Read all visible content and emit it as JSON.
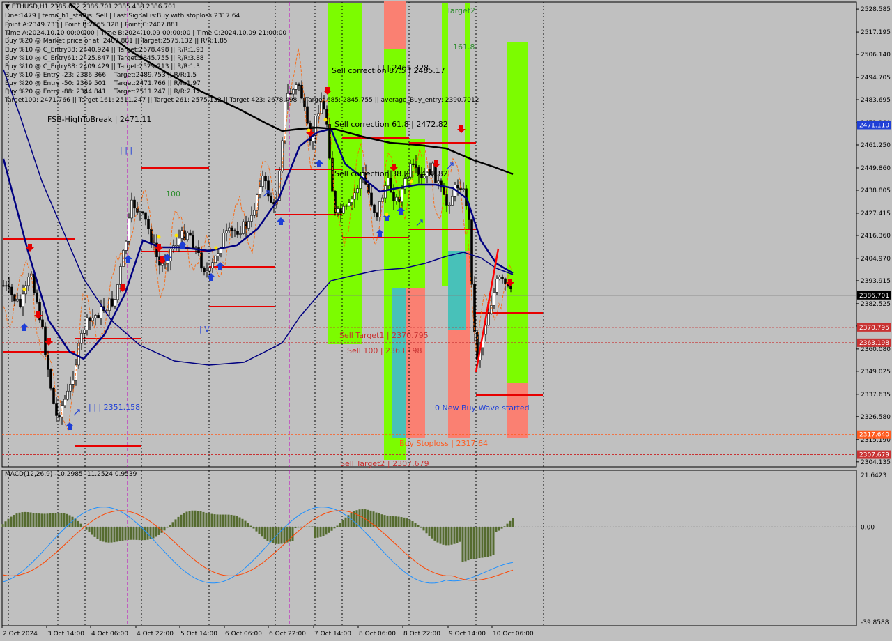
{
  "header": {
    "symbol_line": "ETHUSD,H1  2385.672 2386.701 2385.438 2386.701",
    "lines": [
      "Line:1479 | tema_h1_status: Sell | Last Signal is:Buy with stoploss:2317.64",
      "Point A:2349.733 | Point B:2465.328 | Point C:2407.881",
      "Time A:2024.10.10 00:00:00 | Time B:2024.10.09 00:00:00 | Time C:2024.10.09 21:00:00",
      "Buy %20 @ Market price or at: 2407.881 || Target:2575.132 || R/R:1.85",
      "Buy %10 @ C_Entry38: 2440.924 || Target:2678.498 || R/R:1.93",
      "Buy %10 @ C_Entry61: 2425.847 || Target:2845.755 || R/R:3.88",
      "Buy %10 @ C_Entry88: 2409.429 || Target:2529.213 || R/R:1.3",
      "Buy %10 @ Entry -23: 2386.366 || Target:2489.753 || R/R:1.5",
      "Buy %20 @ Entry -50: 2369.501 || Target:2471.766 || R/R:1.97",
      "Buy %20 @ Entry -88: 2344.841 || Target:2511.247 || R/R:2.12",
      "Target100: 2471.766 || Target 161: 2511.247 || Target 261: 2575.132 || Target 423: 2678.498 || Target 685: 2845.755 || average_Buy_entry: 2390.7012"
    ]
  },
  "chart_data": {
    "type": "candlestick",
    "symbol": "ETHUSD",
    "timeframe": "H1",
    "ohlc_last": {
      "open": 2385.672,
      "high": 2386.701,
      "low": 2385.438,
      "close": 2386.701
    },
    "y_ticks": [
      "2528.585",
      "2517.195",
      "2506.140",
      "2494.705",
      "2483.695",
      "2472.260",
      "2461.250",
      "2449.860",
      "2438.805",
      "2427.415",
      "2416.360",
      "2404.970",
      "2393.915",
      "2382.525",
      "2371.470",
      "2360.080",
      "2349.025",
      "2337.635",
      "2326.580",
      "2315.190",
      "2304.135"
    ],
    "ylim": [
      2302.0,
      2530.0
    ],
    "x_ticks": [
      "2 Oct 2024",
      "3 Oct 14:00",
      "4 Oct 06:00",
      "4 Oct 22:00",
      "5 Oct 14:00",
      "6 Oct 06:00",
      "6 Oct 22:00",
      "7 Oct 14:00",
      "8 Oct 06:00",
      "8 Oct 22:00",
      "9 Oct 14:00",
      "10 Oct 06:00"
    ],
    "price_tags": [
      {
        "label": "2471.110",
        "value": 2471.11,
        "color": "#1f3fd6"
      },
      {
        "label": "2386.701",
        "value": 2386.701,
        "color": "#000000"
      },
      {
        "label": "2370.795",
        "value": 2370.795,
        "color": "#c83232"
      },
      {
        "label": "2363.198",
        "value": 2363.198,
        "color": "#c83232"
      },
      {
        "label": "2317.640",
        "value": 2317.64,
        "color": "#ff5a1e"
      },
      {
        "label": "2307.679",
        "value": 2307.679,
        "color": "#c83232"
      }
    ],
    "annotations": [
      {
        "text": "FSB-HighToBreak | 2471.11",
        "color": "#000000"
      },
      {
        "text": "Sell correction 87.5 | 2485.17",
        "color": "#000000"
      },
      {
        "text": "| | | 2465.328",
        "color": "#000000"
      },
      {
        "text": "Sell correction 61.8 | 2472.82",
        "color": "#000000"
      },
      {
        "text": "Sell correction 38.2 | 2458.82",
        "color": "#000000"
      },
      {
        "text": "Sell Target1 | 2370.795",
        "color": "#c83232"
      },
      {
        "text": "Sell 100 | 2363.198",
        "color": "#c83232"
      },
      {
        "text": "Buy Stoploss | 2317.64",
        "color": "#ff5a1e"
      },
      {
        "text": "Sell Target2 | 2307.679",
        "color": "#c83232"
      },
      {
        "text": "0 New Buy Wave started",
        "color": "#1f3fd6"
      },
      {
        "text": "| | | 2351.158",
        "color": "#1f3fd6"
      },
      {
        "text": "Target2",
        "color": "#2d8c2d"
      },
      {
        "text": "161.8",
        "color": "#2d8c2d"
      },
      {
        "text": "100",
        "color": "#2d8c2d"
      },
      {
        "text": "| | |",
        "color": "#1f3fd6"
      },
      {
        "text": "| V",
        "color": "#1f3fd6"
      }
    ],
    "macd": {
      "label": "MACD(12,26,9) -10.2985 -11.2524 0.9539",
      "y_ticks": [
        "21.6423",
        "0.00",
        "-39.8588"
      ],
      "ylim": [
        -39.8588,
        21.6423
      ]
    }
  },
  "colors": {
    "background": "#c0c0c0",
    "green_zone": "#7cfc00",
    "red_zone": "#fa8072",
    "teal_zone": "#48c1b9",
    "navy_ma": "#000080",
    "black_ma": "#000000",
    "orange_line": "#ff6000",
    "macd_hist": "#556b2f"
  }
}
